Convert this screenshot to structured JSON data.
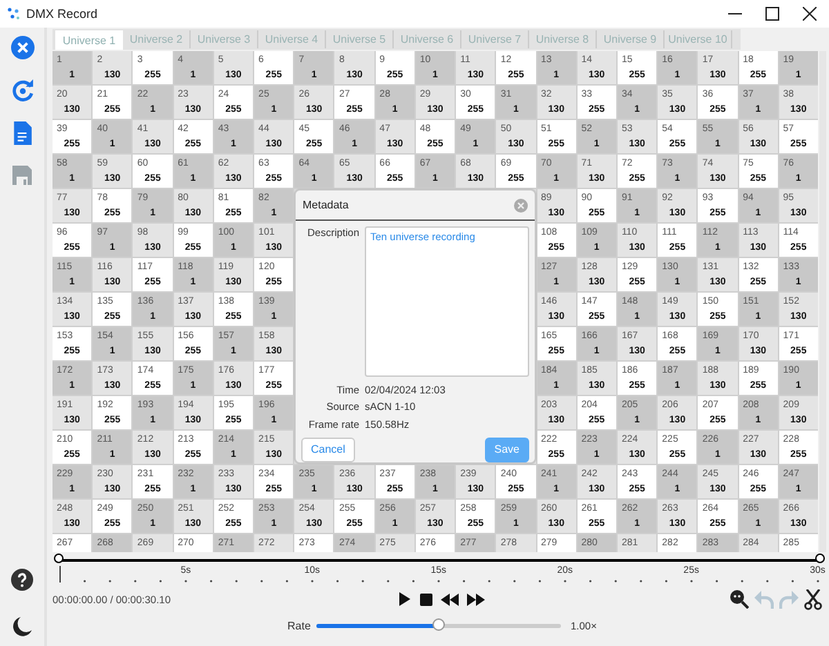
{
  "window": {
    "title": "DMX Record"
  },
  "sidebar": {
    "top": [
      {
        "kind": "close",
        "disabled": false
      },
      {
        "kind": "refresh",
        "disabled": false
      },
      {
        "kind": "document",
        "disabled": false
      },
      {
        "kind": "save",
        "disabled": true
      }
    ],
    "bottom": [
      {
        "kind": "help"
      },
      {
        "kind": "theme"
      }
    ]
  },
  "tabs": [
    {
      "label": "Universe 1",
      "selected": true
    },
    {
      "label": "Universe 2",
      "selected": false
    },
    {
      "label": "Universe 3",
      "selected": false
    },
    {
      "label": "Universe 4",
      "selected": false
    },
    {
      "label": "Universe 5",
      "selected": false
    },
    {
      "label": "Universe 6",
      "selected": false
    },
    {
      "label": "Universe 7",
      "selected": false
    },
    {
      "label": "Universe 8",
      "selected": false
    },
    {
      "label": "Universe 9",
      "selected": false
    },
    {
      "label": "Universe 10",
      "selected": false
    }
  ],
  "grid": {
    "rows": [
      [
        {
          "ch": "1",
          "value": "1",
          "color": "#c8c8c8"
        },
        {
          "ch": "2",
          "value": "130",
          "color": "#e4e4e4"
        },
        {
          "ch": "3",
          "value": "255",
          "color": "#ffffff"
        },
        {
          "ch": "4",
          "value": "1",
          "color": "#c8c8c8"
        },
        {
          "ch": "5",
          "value": "130",
          "color": "#e4e4e4"
        },
        {
          "ch": "6",
          "value": "255",
          "color": "#ffffff"
        },
        {
          "ch": "7",
          "value": "1",
          "color": "#c8c8c8"
        },
        {
          "ch": "8",
          "value": "130",
          "color": "#e4e4e4"
        },
        {
          "ch": "9",
          "value": "255",
          "color": "#ffffff"
        },
        {
          "ch": "10",
          "value": "1",
          "color": "#c8c8c8"
        },
        {
          "ch": "11",
          "value": "130",
          "color": "#e4e4e4"
        },
        {
          "ch": "12",
          "value": "255",
          "color": "#ffffff"
        },
        {
          "ch": "13",
          "value": "1",
          "color": "#c8c8c8"
        },
        {
          "ch": "14",
          "value": "130",
          "color": "#e4e4e4"
        },
        {
          "ch": "15",
          "value": "255",
          "color": "#ffffff"
        },
        {
          "ch": "16",
          "value": "1",
          "color": "#c8c8c8"
        },
        {
          "ch": "17",
          "value": "130",
          "color": "#e4e4e4"
        },
        {
          "ch": "18",
          "value": "255",
          "color": "#ffffff"
        },
        {
          "ch": "19",
          "value": "1",
          "color": "#c8c8c8"
        }
      ],
      [
        {
          "ch": "20",
          "value": "130",
          "color": "#e4e4e4"
        },
        {
          "ch": "21",
          "value": "255",
          "color": "#ffffff"
        },
        {
          "ch": "22",
          "value": "1",
          "color": "#c8c8c8"
        },
        {
          "ch": "23",
          "value": "130",
          "color": "#e4e4e4"
        },
        {
          "ch": "24",
          "value": "255",
          "color": "#ffffff"
        },
        {
          "ch": "25",
          "value": "1",
          "color": "#c8c8c8"
        },
        {
          "ch": "26",
          "value": "130",
          "color": "#e4e4e4"
        },
        {
          "ch": "27",
          "value": "255",
          "color": "#ffffff"
        },
        {
          "ch": "28",
          "value": "1",
          "color": "#c8c8c8"
        },
        {
          "ch": "29",
          "value": "130",
          "color": "#e4e4e4"
        },
        {
          "ch": "30",
          "value": "255",
          "color": "#ffffff"
        },
        {
          "ch": "31",
          "value": "1",
          "color": "#c8c8c8"
        },
        {
          "ch": "32",
          "value": "130",
          "color": "#e4e4e4"
        },
        {
          "ch": "33",
          "value": "255",
          "color": "#ffffff"
        },
        {
          "ch": "34",
          "value": "1",
          "color": "#c8c8c8"
        },
        {
          "ch": "35",
          "value": "130",
          "color": "#e4e4e4"
        },
        {
          "ch": "36",
          "value": "255",
          "color": "#ffffff"
        },
        {
          "ch": "37",
          "value": "1",
          "color": "#c8c8c8"
        },
        {
          "ch": "38",
          "value": "130",
          "color": "#e4e4e4"
        }
      ],
      [
        {
          "ch": "39",
          "value": "255",
          "color": "#ffffff"
        },
        {
          "ch": "40",
          "value": "1",
          "color": "#c8c8c8"
        },
        {
          "ch": "41",
          "value": "130",
          "color": "#e4e4e4"
        },
        {
          "ch": "42",
          "value": "255",
          "color": "#ffffff"
        },
        {
          "ch": "43",
          "value": "1",
          "color": "#c8c8c8"
        },
        {
          "ch": "44",
          "value": "130",
          "color": "#e4e4e4"
        },
        {
          "ch": "45",
          "value": "255",
          "color": "#ffffff"
        },
        {
          "ch": "46",
          "value": "1",
          "color": "#c8c8c8"
        },
        {
          "ch": "47",
          "value": "130",
          "color": "#e4e4e4"
        },
        {
          "ch": "48",
          "value": "255",
          "color": "#ffffff"
        },
        {
          "ch": "49",
          "value": "1",
          "color": "#c8c8c8"
        },
        {
          "ch": "50",
          "value": "130",
          "color": "#e4e4e4"
        },
        {
          "ch": "51",
          "value": "255",
          "color": "#ffffff"
        },
        {
          "ch": "52",
          "value": "1",
          "color": "#c8c8c8"
        },
        {
          "ch": "53",
          "value": "130",
          "color": "#e4e4e4"
        },
        {
          "ch": "54",
          "value": "255",
          "color": "#ffffff"
        },
        {
          "ch": "55",
          "value": "1",
          "color": "#c8c8c8"
        },
        {
          "ch": "56",
          "value": "130",
          "color": "#e4e4e4"
        },
        {
          "ch": "57",
          "value": "255",
          "color": "#ffffff"
        }
      ],
      [
        {
          "ch": "58",
          "value": "1",
          "color": "#c8c8c8"
        },
        {
          "ch": "59",
          "value": "130",
          "color": "#e4e4e4"
        },
        {
          "ch": "60",
          "value": "255",
          "color": "#ffffff"
        },
        {
          "ch": "61",
          "value": "1",
          "color": "#c8c8c8"
        },
        {
          "ch": "62",
          "value": "130",
          "color": "#e4e4e4"
        },
        {
          "ch": "63",
          "value": "255",
          "color": "#ffffff"
        },
        {
          "ch": "64",
          "value": "1",
          "color": "#c8c8c8"
        },
        {
          "ch": "65",
          "value": "130",
          "color": "#e4e4e4"
        },
        {
          "ch": "66",
          "value": "255",
          "color": "#ffffff"
        },
        {
          "ch": "67",
          "value": "1",
          "color": "#c8c8c8"
        },
        {
          "ch": "68",
          "value": "130",
          "color": "#e4e4e4"
        },
        {
          "ch": "69",
          "value": "255",
          "color": "#ffffff"
        },
        {
          "ch": "70",
          "value": "1",
          "color": "#c8c8c8"
        },
        {
          "ch": "71",
          "value": "130",
          "color": "#e4e4e4"
        },
        {
          "ch": "72",
          "value": "255",
          "color": "#ffffff"
        },
        {
          "ch": "73",
          "value": "1",
          "color": "#c8c8c8"
        },
        {
          "ch": "74",
          "value": "130",
          "color": "#e4e4e4"
        },
        {
          "ch": "75",
          "value": "255",
          "color": "#ffffff"
        },
        {
          "ch": "76",
          "value": "1",
          "color": "#c8c8c8"
        }
      ],
      [
        {
          "ch": "77",
          "value": "130",
          "color": "#e4e4e4"
        },
        {
          "ch": "78",
          "value": "255",
          "color": "#ffffff"
        },
        {
          "ch": "79",
          "value": "1",
          "color": "#c8c8c8"
        },
        {
          "ch": "80",
          "value": "130",
          "color": "#e4e4e4"
        },
        {
          "ch": "81",
          "value": "255",
          "color": "#ffffff"
        },
        {
          "ch": "82",
          "value": "1",
          "color": "#c8c8c8"
        },
        null,
        null,
        null,
        null,
        null,
        null,
        {
          "ch": "89",
          "value": "130",
          "color": "#e4e4e4"
        },
        {
          "ch": "90",
          "value": "255",
          "color": "#ffffff"
        },
        {
          "ch": "91",
          "value": "1",
          "color": "#c8c8c8"
        },
        {
          "ch": "92",
          "value": "130",
          "color": "#e4e4e4"
        },
        {
          "ch": "93",
          "value": "255",
          "color": "#ffffff"
        },
        {
          "ch": "94",
          "value": "1",
          "color": "#c8c8c8"
        },
        {
          "ch": "95",
          "value": "130",
          "color": "#e4e4e4"
        }
      ],
      [
        {
          "ch": "96",
          "value": "255",
          "color": "#ffffff"
        },
        {
          "ch": "97",
          "value": "1",
          "color": "#c8c8c8"
        },
        {
          "ch": "98",
          "value": "130",
          "color": "#e4e4e4"
        },
        {
          "ch": "99",
          "value": "255",
          "color": "#ffffff"
        },
        {
          "ch": "100",
          "value": "1",
          "color": "#c8c8c8"
        },
        {
          "ch": "101",
          "value": "130",
          "color": "#e4e4e4"
        },
        null,
        null,
        null,
        null,
        null,
        null,
        {
          "ch": "108",
          "value": "255",
          "color": "#ffffff"
        },
        {
          "ch": "109",
          "value": "1",
          "color": "#c8c8c8"
        },
        {
          "ch": "110",
          "value": "130",
          "color": "#e4e4e4"
        },
        {
          "ch": "111",
          "value": "255",
          "color": "#ffffff"
        },
        {
          "ch": "112",
          "value": "1",
          "color": "#c8c8c8"
        },
        {
          "ch": "113",
          "value": "130",
          "color": "#e4e4e4"
        },
        {
          "ch": "114",
          "value": "255",
          "color": "#ffffff"
        }
      ],
      [
        {
          "ch": "115",
          "value": "1",
          "color": "#c8c8c8"
        },
        {
          "ch": "116",
          "value": "130",
          "color": "#e4e4e4"
        },
        {
          "ch": "117",
          "value": "255",
          "color": "#ffffff"
        },
        {
          "ch": "118",
          "value": "1",
          "color": "#c8c8c8"
        },
        {
          "ch": "119",
          "value": "130",
          "color": "#e4e4e4"
        },
        {
          "ch": "120",
          "value": "255",
          "color": "#ffffff"
        },
        null,
        null,
        null,
        null,
        null,
        null,
        {
          "ch": "127",
          "value": "1",
          "color": "#c8c8c8"
        },
        {
          "ch": "128",
          "value": "130",
          "color": "#e4e4e4"
        },
        {
          "ch": "129",
          "value": "255",
          "color": "#ffffff"
        },
        {
          "ch": "130",
          "value": "1",
          "color": "#c8c8c8"
        },
        {
          "ch": "131",
          "value": "130",
          "color": "#e4e4e4"
        },
        {
          "ch": "132",
          "value": "255",
          "color": "#ffffff"
        },
        {
          "ch": "133",
          "value": "1",
          "color": "#c8c8c8"
        }
      ],
      [
        {
          "ch": "134",
          "value": "130",
          "color": "#e4e4e4"
        },
        {
          "ch": "135",
          "value": "255",
          "color": "#ffffff"
        },
        {
          "ch": "136",
          "value": "1",
          "color": "#c8c8c8"
        },
        {
          "ch": "137",
          "value": "130",
          "color": "#e4e4e4"
        },
        {
          "ch": "138",
          "value": "255",
          "color": "#ffffff"
        },
        {
          "ch": "139",
          "value": "1",
          "color": "#c8c8c8"
        },
        null,
        null,
        null,
        null,
        null,
        null,
        {
          "ch": "146",
          "value": "130",
          "color": "#e4e4e4"
        },
        {
          "ch": "147",
          "value": "255",
          "color": "#ffffff"
        },
        {
          "ch": "148",
          "value": "1",
          "color": "#c8c8c8"
        },
        {
          "ch": "149",
          "value": "130",
          "color": "#e4e4e4"
        },
        {
          "ch": "150",
          "value": "255",
          "color": "#ffffff"
        },
        {
          "ch": "151",
          "value": "1",
          "color": "#c8c8c8"
        },
        {
          "ch": "152",
          "value": "130",
          "color": "#e4e4e4"
        }
      ],
      [
        {
          "ch": "153",
          "value": "255",
          "color": "#ffffff"
        },
        {
          "ch": "154",
          "value": "1",
          "color": "#c8c8c8"
        },
        {
          "ch": "155",
          "value": "130",
          "color": "#e4e4e4"
        },
        {
          "ch": "156",
          "value": "255",
          "color": "#ffffff"
        },
        {
          "ch": "157",
          "value": "1",
          "color": "#c8c8c8"
        },
        {
          "ch": "158",
          "value": "130",
          "color": "#e4e4e4"
        },
        null,
        null,
        null,
        null,
        null,
        null,
        {
          "ch": "165",
          "value": "255",
          "color": "#ffffff"
        },
        {
          "ch": "166",
          "value": "1",
          "color": "#c8c8c8"
        },
        {
          "ch": "167",
          "value": "130",
          "color": "#e4e4e4"
        },
        {
          "ch": "168",
          "value": "255",
          "color": "#ffffff"
        },
        {
          "ch": "169",
          "value": "1",
          "color": "#c8c8c8"
        },
        {
          "ch": "170",
          "value": "130",
          "color": "#e4e4e4"
        },
        {
          "ch": "171",
          "value": "255",
          "color": "#ffffff"
        }
      ],
      [
        {
          "ch": "172",
          "value": "1",
          "color": "#c8c8c8"
        },
        {
          "ch": "173",
          "value": "130",
          "color": "#e4e4e4"
        },
        {
          "ch": "174",
          "value": "255",
          "color": "#ffffff"
        },
        {
          "ch": "175",
          "value": "1",
          "color": "#c8c8c8"
        },
        {
          "ch": "176",
          "value": "130",
          "color": "#e4e4e4"
        },
        {
          "ch": "177",
          "value": "255",
          "color": "#ffffff"
        },
        null,
        null,
        null,
        null,
        null,
        null,
        {
          "ch": "184",
          "value": "1",
          "color": "#c8c8c8"
        },
        {
          "ch": "185",
          "value": "130",
          "color": "#e4e4e4"
        },
        {
          "ch": "186",
          "value": "255",
          "color": "#ffffff"
        },
        {
          "ch": "187",
          "value": "1",
          "color": "#c8c8c8"
        },
        {
          "ch": "188",
          "value": "130",
          "color": "#e4e4e4"
        },
        {
          "ch": "189",
          "value": "255",
          "color": "#ffffff"
        },
        {
          "ch": "190",
          "value": "1",
          "color": "#c8c8c8"
        }
      ],
      [
        {
          "ch": "191",
          "value": "130",
          "color": "#e4e4e4"
        },
        {
          "ch": "192",
          "value": "255",
          "color": "#ffffff"
        },
        {
          "ch": "193",
          "value": "1",
          "color": "#c8c8c8"
        },
        {
          "ch": "194",
          "value": "130",
          "color": "#e4e4e4"
        },
        {
          "ch": "195",
          "value": "255",
          "color": "#ffffff"
        },
        {
          "ch": "196",
          "value": "1",
          "color": "#c8c8c8"
        },
        null,
        null,
        null,
        null,
        null,
        null,
        {
          "ch": "203",
          "value": "130",
          "color": "#e4e4e4"
        },
        {
          "ch": "204",
          "value": "255",
          "color": "#ffffff"
        },
        {
          "ch": "205",
          "value": "1",
          "color": "#c8c8c8"
        },
        {
          "ch": "206",
          "value": "130",
          "color": "#e4e4e4"
        },
        {
          "ch": "207",
          "value": "255",
          "color": "#ffffff"
        },
        {
          "ch": "208",
          "value": "1",
          "color": "#c8c8c8"
        },
        {
          "ch": "209",
          "value": "130",
          "color": "#e4e4e4"
        }
      ],
      [
        {
          "ch": "210",
          "value": "255",
          "color": "#ffffff"
        },
        {
          "ch": "211",
          "value": "1",
          "color": "#c8c8c8"
        },
        {
          "ch": "212",
          "value": "130",
          "color": "#e4e4e4"
        },
        {
          "ch": "213",
          "value": "255",
          "color": "#ffffff"
        },
        {
          "ch": "214",
          "value": "1",
          "color": "#c8c8c8"
        },
        {
          "ch": "215",
          "value": "130",
          "color": "#e4e4e4"
        },
        null,
        null,
        null,
        null,
        null,
        null,
        {
          "ch": "222",
          "value": "255",
          "color": "#ffffff"
        },
        {
          "ch": "223",
          "value": "1",
          "color": "#c8c8c8"
        },
        {
          "ch": "224",
          "value": "130",
          "color": "#e4e4e4"
        },
        {
          "ch": "225",
          "value": "255",
          "color": "#ffffff"
        },
        {
          "ch": "226",
          "value": "1",
          "color": "#c8c8c8"
        },
        {
          "ch": "227",
          "value": "130",
          "color": "#e4e4e4"
        },
        {
          "ch": "228",
          "value": "255",
          "color": "#ffffff"
        }
      ],
      [
        {
          "ch": "229",
          "value": "1",
          "color": "#c8c8c8"
        },
        {
          "ch": "230",
          "value": "130",
          "color": "#e4e4e4"
        },
        {
          "ch": "231",
          "value": "255",
          "color": "#ffffff"
        },
        {
          "ch": "232",
          "value": "1",
          "color": "#c8c8c8"
        },
        {
          "ch": "233",
          "value": "130",
          "color": "#e4e4e4"
        },
        {
          "ch": "234",
          "value": "255",
          "color": "#ffffff"
        },
        {
          "ch": "235",
          "value": "1",
          "color": "#c8c8c8"
        },
        {
          "ch": "236",
          "value": "130",
          "color": "#e4e4e4"
        },
        {
          "ch": "237",
          "value": "255",
          "color": "#ffffff"
        },
        {
          "ch": "238",
          "value": "1",
          "color": "#c8c8c8"
        },
        {
          "ch": "239",
          "value": "130",
          "color": "#e4e4e4"
        },
        {
          "ch": "240",
          "value": "255",
          "color": "#ffffff"
        },
        {
          "ch": "241",
          "value": "1",
          "color": "#c8c8c8"
        },
        {
          "ch": "242",
          "value": "130",
          "color": "#e4e4e4"
        },
        {
          "ch": "243",
          "value": "255",
          "color": "#ffffff"
        },
        {
          "ch": "244",
          "value": "1",
          "color": "#c8c8c8"
        },
        {
          "ch": "245",
          "value": "130",
          "color": "#e4e4e4"
        },
        {
          "ch": "246",
          "value": "255",
          "color": "#ffffff"
        },
        {
          "ch": "247",
          "value": "1",
          "color": "#c8c8c8"
        }
      ],
      [
        {
          "ch": "248",
          "value": "130",
          "color": "#e4e4e4"
        },
        {
          "ch": "249",
          "value": "255",
          "color": "#ffffff"
        },
        {
          "ch": "250",
          "value": "1",
          "color": "#c8c8c8"
        },
        {
          "ch": "251",
          "value": "130",
          "color": "#e4e4e4"
        },
        {
          "ch": "252",
          "value": "255",
          "color": "#ffffff"
        },
        {
          "ch": "253",
          "value": "1",
          "color": "#c8c8c8"
        },
        {
          "ch": "254",
          "value": "130",
          "color": "#e4e4e4"
        },
        {
          "ch": "255",
          "value": "255",
          "color": "#ffffff"
        },
        {
          "ch": "256",
          "value": "1",
          "color": "#c8c8c8"
        },
        {
          "ch": "257",
          "value": "130",
          "color": "#e4e4e4"
        },
        {
          "ch": "258",
          "value": "255",
          "color": "#ffffff"
        },
        {
          "ch": "259",
          "value": "1",
          "color": "#c8c8c8"
        },
        {
          "ch": "260",
          "value": "130",
          "color": "#e4e4e4"
        },
        {
          "ch": "261",
          "value": "255",
          "color": "#ffffff"
        },
        {
          "ch": "262",
          "value": "1",
          "color": "#c8c8c8"
        },
        {
          "ch": "263",
          "value": "130",
          "color": "#e4e4e4"
        },
        {
          "ch": "264",
          "value": "255",
          "color": "#ffffff"
        },
        {
          "ch": "265",
          "value": "1",
          "color": "#c8c8c8"
        },
        {
          "ch": "266",
          "value": "130",
          "color": "#e4e4e4"
        }
      ],
      [
        {
          "ch": "267",
          "color": "#ffffff"
        },
        {
          "ch": "268",
          "color": "#c8c8c8"
        },
        {
          "ch": "269",
          "color": "#e4e4e4"
        },
        {
          "ch": "270",
          "color": "#ffffff"
        },
        {
          "ch": "271",
          "color": "#c8c8c8"
        },
        {
          "ch": "272",
          "color": "#e4e4e4"
        },
        {
          "ch": "273",
          "color": "#ffffff"
        },
        {
          "ch": "274",
          "color": "#c8c8c8"
        },
        {
          "ch": "275",
          "color": "#e4e4e4"
        },
        {
          "ch": "276",
          "color": "#ffffff"
        },
        {
          "ch": "277",
          "color": "#c8c8c8"
        },
        {
          "ch": "278",
          "color": "#e4e4e4"
        },
        {
          "ch": "279",
          "color": "#ffffff"
        },
        {
          "ch": "280",
          "color": "#c8c8c8"
        },
        {
          "ch": "281",
          "color": "#e4e4e4"
        },
        {
          "ch": "282",
          "color": "#ffffff"
        },
        {
          "ch": "283",
          "color": "#c8c8c8"
        },
        {
          "ch": "284",
          "color": "#e4e4e4"
        },
        {
          "ch": "285",
          "color": "#ffffff"
        }
      ]
    ]
  },
  "dialog": {
    "title": "Metadata",
    "description": {
      "label": "Description",
      "value": "Ten universe recording"
    },
    "info": [
      {
        "label": "Time",
        "value": "02/04/2024 12:03"
      },
      {
        "label": "Source",
        "value": "sACN 1-10"
      },
      {
        "label": "Frame rate",
        "value": "150.58Hz"
      }
    ],
    "buttons": [
      {
        "label": "Cancel",
        "primary": false
      },
      {
        "label": "Save",
        "primary": true
      }
    ]
  },
  "timeline": {
    "handles": [
      {
        "level": 0
      },
      {
        "level": 1
      }
    ],
    "ticks": [
      "5s",
      "10s",
      "15s",
      "20s",
      "25s",
      "30s"
    ],
    "time": "00:00:00.00 / 00:00:30.10",
    "transport": [
      {
        "kind": "play"
      },
      {
        "kind": "stop"
      },
      {
        "kind": "rewind"
      },
      {
        "kind": "fast_forward"
      }
    ],
    "tools": [
      {
        "kind": "zoom",
        "disabled": false
      },
      {
        "kind": "undo",
        "disabled": true
      },
      {
        "kind": "redo",
        "disabled": true
      },
      {
        "kind": "cut",
        "disabled": false
      }
    ],
    "rate": {
      "label": "Rate",
      "level": 0.5,
      "reading": "1.00×"
    }
  }
}
